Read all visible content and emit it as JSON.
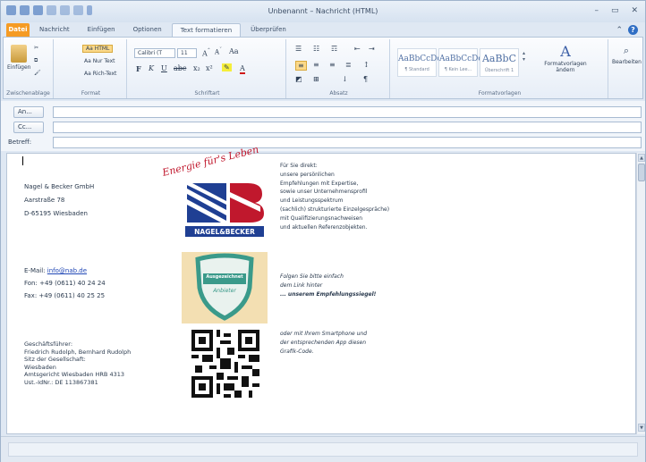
{
  "window": {
    "title": "Unbenannt – Nachricht (HTML)",
    "controls": [
      "–",
      "▭",
      "✕"
    ]
  },
  "tabs": [
    {
      "label": "Datei"
    },
    {
      "label": "Nachricht"
    },
    {
      "label": "Einfügen"
    },
    {
      "label": "Optionen"
    },
    {
      "label": "Text formatieren"
    },
    {
      "label": "Überprüfen"
    }
  ],
  "ribbon": {
    "clipboard": {
      "label": "Zwischenablage",
      "paste": "Einfügen"
    },
    "format": {
      "label": "Format",
      "items": [
        "Aa HTML",
        "Aa Nur Text",
        "Aa Rich-Text"
      ]
    },
    "font": {
      "label": "Schriftart",
      "family": "Calibri (T",
      "size": "11"
    },
    "paragraph": {
      "label": "Absatz"
    },
    "styles": {
      "label": "Formatvorlagen",
      "items": [
        {
          "sample": "AaBbCcDc",
          "name": "¶ Standard"
        },
        {
          "sample": "AaBbCcDc",
          "name": "¶ Kein Lee..."
        },
        {
          "sample": "AaBbC",
          "name": "Überschrift 1"
        }
      ],
      "change": "Formatvorlagen ändern"
    },
    "editing": {
      "label": "Bearbeiten"
    }
  },
  "header": {
    "to_button": "An...",
    "cc_button": "Cc...",
    "subject_label": "Betreff:"
  },
  "signature": {
    "company": "Nagel & Becker GmbH",
    "street": "Aarstraße 78",
    "city": "D-65195 Wiesbaden",
    "email_label": "E-Mail:",
    "email": "info@nab.de",
    "phone": "Fon: +49 (0611) 40 24 24",
    "fax": "Fax: +49 (0611) 40 25 25",
    "legal": [
      "Geschäftsführer:",
      "Friedrich Rudolph, Bernhard Rudolph",
      "Sitz der Gesellschaft:",
      "Wiesbaden",
      "Amtsgericht Wiesbaden HRB 4313",
      "Ust.-IdNr.: DE 113867381"
    ],
    "slogan": "Energie für's Leben",
    "logo_text": "NAGEL&BECKER",
    "badge_line1": "Ausgezeichnet",
    "badge_line2": "Anbieter",
    "promo": [
      "Für Sie direkt:",
      "unsere persönlichen",
      "Empfehlungen mit Expertise,",
      "sowie unser Unternehmensprofil",
      "und Leistungsspektrum",
      "(sachlich) strukturierte Einzelgespräche)",
      "mit Qualifizierungsnachweisen",
      "und aktuellen Referenzobjekten."
    ],
    "cta_1": "Folgen Sie bitte einfach",
    "cta_2": "dem Link hinter",
    "cta_3": "... unserem Empfehlungssiegel!",
    "qr_text": [
      "oder mit Ihrem Smartphone und",
      "der entsprechenden App diesen",
      "Grafik-Code."
    ]
  },
  "colors": {
    "accent": "#2f6ec4",
    "file_tab": "#f59b24",
    "logo_red": "#c0182d",
    "logo_blue": "#1f3f93",
    "badge_green": "#3a9a8a"
  }
}
